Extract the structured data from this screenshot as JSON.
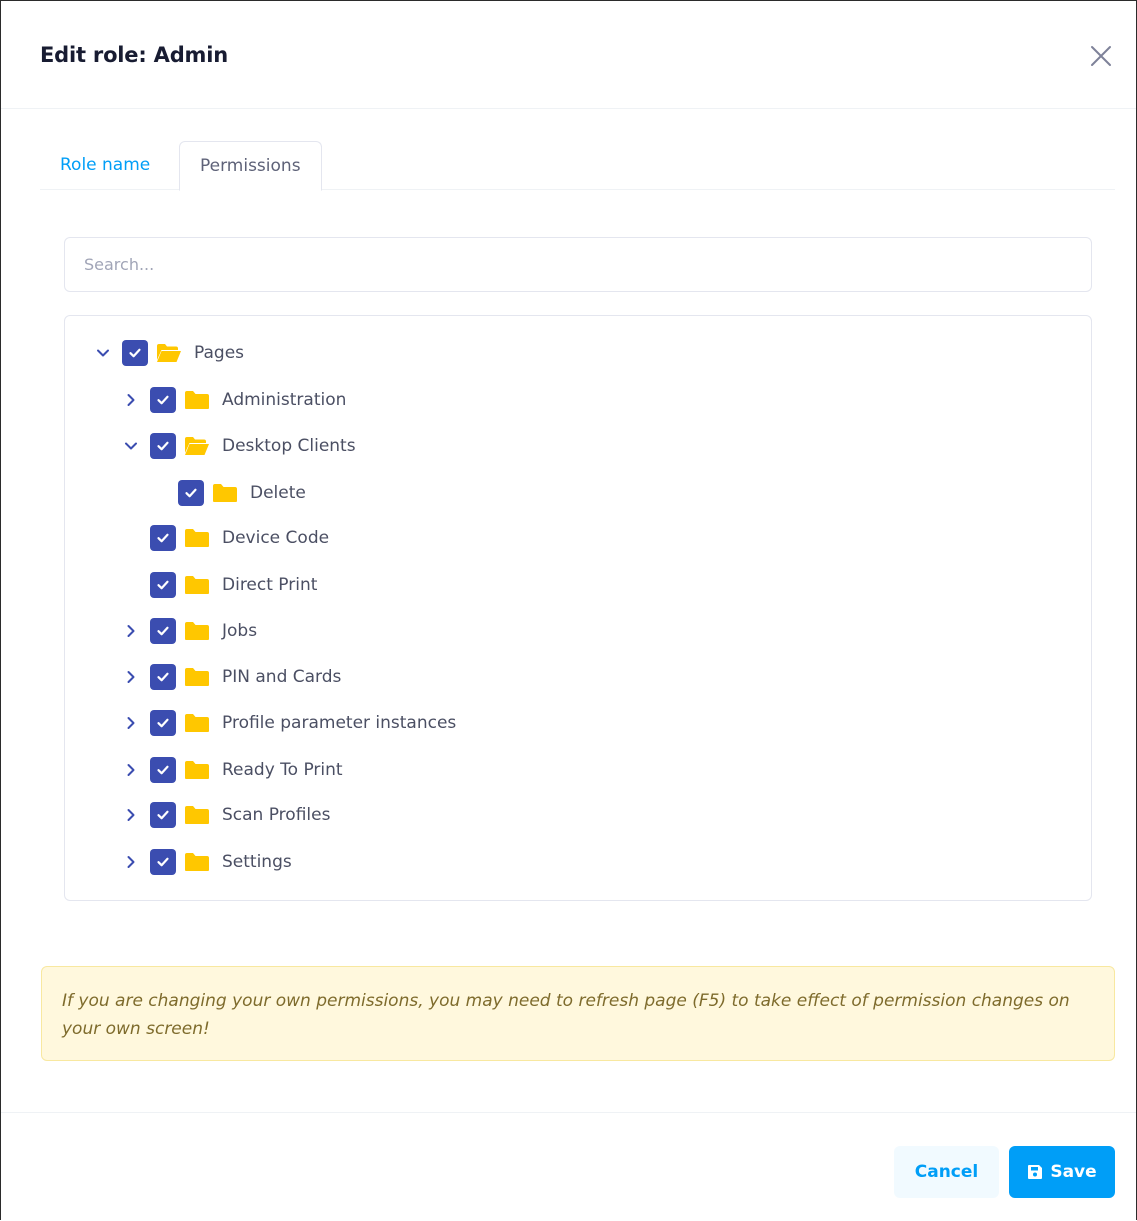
{
  "dialog": {
    "title": "Edit role: Admin"
  },
  "tabs": {
    "role_name": "Role name",
    "permissions": "Permissions",
    "active": "Permissions"
  },
  "search": {
    "placeholder": "Search...",
    "value": ""
  },
  "tree": {
    "nodes": [
      {
        "label": "Pages",
        "checked": true,
        "expanded": true
      },
      {
        "label": "Administration",
        "checked": true,
        "expanded": false
      },
      {
        "label": "Desktop Clients",
        "checked": true,
        "expanded": true
      },
      {
        "label": "Delete",
        "checked": true
      },
      {
        "label": "Device Code",
        "checked": true
      },
      {
        "label": "Direct Print",
        "checked": true
      },
      {
        "label": "Jobs",
        "checked": true,
        "expanded": false
      },
      {
        "label": "PIN and Cards",
        "checked": true,
        "expanded": false
      },
      {
        "label": "Profile parameter instances",
        "checked": true,
        "expanded": false
      },
      {
        "label": "Ready To Print",
        "checked": true,
        "expanded": false
      },
      {
        "label": "Scan Profiles",
        "checked": true,
        "expanded": false
      },
      {
        "label": "Settings",
        "checked": true,
        "expanded": false
      }
    ]
  },
  "alert": {
    "text": "If you are changing your own permissions, you may need to refresh page (F5) to take effect of permission changes on your own screen!"
  },
  "footer": {
    "cancel_label": "Cancel",
    "save_label": "Save"
  },
  "colors": {
    "primary": "#009ef7",
    "checkbox": "#3b4db0",
    "folder": "#ffc700",
    "alert_bg": "#fff8dd"
  }
}
